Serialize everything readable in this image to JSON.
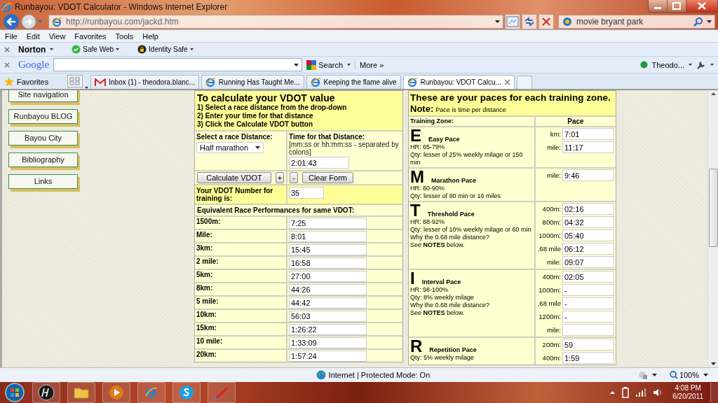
{
  "window": {
    "title": "Runbayou: VDOT Calculator - Windows Internet Explorer"
  },
  "address_bar": {
    "url": "http://runbayou.com/jackd.htm"
  },
  "search_box": {
    "value": "movie bryant park"
  },
  "menu_bar": [
    "File",
    "Edit",
    "View",
    "Favorites",
    "Tools",
    "Help"
  ],
  "norton_toolbar": {
    "brand": "Norton",
    "items": [
      "Safe Web",
      "Identity Safe"
    ]
  },
  "google_toolbar": {
    "brand": "Google",
    "search_button": "Search",
    "more": "More »",
    "user": "Theodo..."
  },
  "favorites_bar": {
    "label": "Favorites",
    "tabs": [
      {
        "title": "Inbox (1) - theodora.blanc...",
        "kind": "mail",
        "selected": false
      },
      {
        "title": "Running Has Taught Me...",
        "kind": "page",
        "selected": false
      },
      {
        "title": "Keeping the flame alive",
        "kind": "page",
        "selected": false
      },
      {
        "title": "Runbayou: VDOT Calcu...",
        "kind": "page",
        "selected": true
      }
    ]
  },
  "sidebar": {
    "items": [
      "Site navigation",
      "Runbayou BLOG",
      "Bayou City",
      "Bibliography",
      "Links"
    ]
  },
  "calculator": {
    "title": "To calculate your VDOT value",
    "steps": [
      "1) Select a race distance from the drop-down",
      "2) Enter your time for that distance",
      "3) Click the Calculate VDOT button"
    ],
    "distance_label": "Select a race Distance:",
    "distance_value": "Half marathon",
    "time_label": "Time for that Distance:",
    "time_hint": "[mm:ss or hh:mm:ss - separated by colons]",
    "time_value": "2:01:43",
    "calculate_button": "Calculate VDOT",
    "plus_button": "+",
    "minus_button": "-",
    "clear_button": "Clear Form",
    "vdot_label": "Your VDOT Number for training is:",
    "vdot_value": "35",
    "equivalent_heading": "Equivalent Race Performances for same VDOT:",
    "performances": [
      {
        "distance": "1500m:",
        "time": "7:25"
      },
      {
        "distance": "Mile:",
        "time": "8:01"
      },
      {
        "distance": "3km:",
        "time": "15:45"
      },
      {
        "distance": "2 mile:",
        "time": "16:58"
      },
      {
        "distance": "5km:",
        "time": "27:00"
      },
      {
        "distance": "8km:",
        "time": "44:26"
      },
      {
        "distance": "5 mile:",
        "time": "44:42"
      },
      {
        "distance": "10km:",
        "time": "56:03"
      },
      {
        "distance": "15km:",
        "time": "1:26:22"
      },
      {
        "distance": "10 mile:",
        "time": "1:33:09"
      },
      {
        "distance": "20km:",
        "time": "1:57:24"
      }
    ]
  },
  "paces": {
    "title": "These are your paces for each training zone.",
    "note_label": "Note:",
    "note": "Pace is time per distance",
    "columns": [
      "Training Zone:",
      "Pace"
    ],
    "zones": [
      {
        "letter": "E",
        "name": "Easy Pace",
        "details": [
          "HR: 65-79%",
          "Qty: lesser of 25% weekly milage or 150 min"
        ],
        "paces": [
          {
            "distance": "km:",
            "value": "7:01"
          },
          {
            "distance": "mile:",
            "value": "11:17"
          }
        ]
      },
      {
        "letter": "M",
        "name": "Marathon Pace",
        "details": [
          "HR: 80-90%",
          "Qty: lesser of 90 min or 16 miles"
        ],
        "paces": [
          {
            "distance": "mile:",
            "value": "9:46"
          }
        ]
      },
      {
        "letter": "T",
        "name": "Threshold Pace",
        "details": [
          "HR: 88-92%",
          "Qty: lesser of 10% weekly milage or 60 min",
          "Why the 0.68 mile distance?",
          "See **NOTES** below."
        ],
        "paces": [
          {
            "distance": "400m:",
            "value": "02:16"
          },
          {
            "distance": "800m:",
            "value": "04:32"
          },
          {
            "distance": "1000m:",
            "value": "05:40"
          },
          {
            "distance": ".68 mile",
            "value": "06:12"
          },
          {
            "distance": "mile:",
            "value": "09:07"
          }
        ]
      },
      {
        "letter": "I",
        "name": "Interval Pace",
        "details": [
          "HR: 98-100%",
          "Qty: 8% weekly milage",
          "Why the 0.68 mile distance?",
          "See **NOTES** below."
        ],
        "paces": [
          {
            "distance": "400m:",
            "value": "02:05"
          },
          {
            "distance": "1000m:",
            "value": "-"
          },
          {
            "distance": ".68 mile",
            "value": "-"
          },
          {
            "distance": "1200m:",
            "value": "-"
          },
          {
            "distance": "mile:"
          }
        ]
      },
      {
        "letter": "R",
        "name": "Repetition Pace",
        "details": [
          "Qty: 5% weekly milage"
        ],
        "paces": [
          {
            "distance": "200m:",
            "value": "59"
          },
          {
            "distance": "400m:",
            "value": "1:59"
          }
        ]
      }
    ]
  },
  "status_bar": {
    "zone": "Internet | Protected Mode: On",
    "zoom": "100%"
  },
  "taskbar": {
    "time": "4:08 PM",
    "date": "6/20/2011"
  }
}
